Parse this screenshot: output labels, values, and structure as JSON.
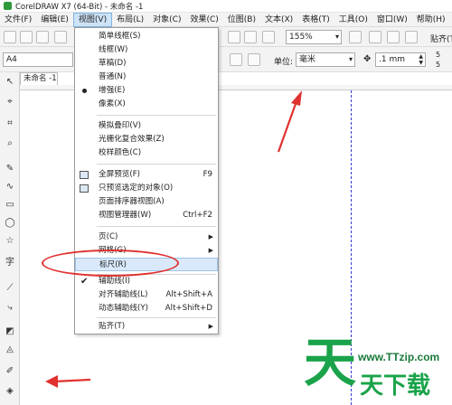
{
  "window": {
    "title": "CorelDRAW X7 (64-Bit) - 未命名 -1"
  },
  "menubar": {
    "items": [
      "文件(F)",
      "编辑(E)",
      "视图(V)",
      "布局(L)",
      "对象(C)",
      "效果(C)",
      "位图(B)",
      "文本(X)",
      "表格(T)",
      "工具(O)",
      "窗口(W)",
      "帮助(H)"
    ],
    "active": "视图(V)"
  },
  "toolbar": {
    "zoom": "155%",
    "snap_label": "贴齐(T)"
  },
  "property_bar": {
    "page_size": "A4",
    "unit_label": "单位:",
    "unit_value": "毫米",
    "nudge_value": ".1 mm",
    "dup_x": "5",
    "dup_y": "5"
  },
  "document": {
    "tab_label": "未命名 -1"
  },
  "view_menu": {
    "items": [
      {
        "label": "简单线框(S)"
      },
      {
        "label": "线框(W)"
      },
      {
        "label": "草稿(D)"
      },
      {
        "label": "普通(N)"
      },
      {
        "label": "增强(E)"
      },
      {
        "label": "像素(X)"
      },
      {
        "label": "模拟叠印(V)"
      },
      {
        "label": "光栅化复合效果(Z)"
      },
      {
        "label": "校样颜色(C)"
      },
      {
        "label": "全屏预览(F)",
        "shortcut": "F9"
      },
      {
        "label": "只预览选定的对象(O)"
      },
      {
        "label": "页面排序器视图(A)"
      },
      {
        "label": "视图管理器(W)",
        "shortcut": "Ctrl+F2"
      },
      {
        "label": "页(C)"
      },
      {
        "label": "网格(G)"
      },
      {
        "label": "标尺(R)"
      },
      {
        "label": "辅助线(I)"
      },
      {
        "label": "对齐辅助线(L)",
        "shortcut": "Alt+Shift+A"
      },
      {
        "label": "动态辅助线(Y)",
        "shortcut": "Alt+Shift+D"
      },
      {
        "label": "贴齐(T)"
      }
    ]
  },
  "watermark": {
    "big_char": "天",
    "url": "www.TTzip.com",
    "sub": "天下载"
  },
  "colors": {
    "annotation": "#e0322f",
    "watermark": "#1aa34a",
    "highlight": "#d9e9fb",
    "guide": "#3a3ad0"
  }
}
